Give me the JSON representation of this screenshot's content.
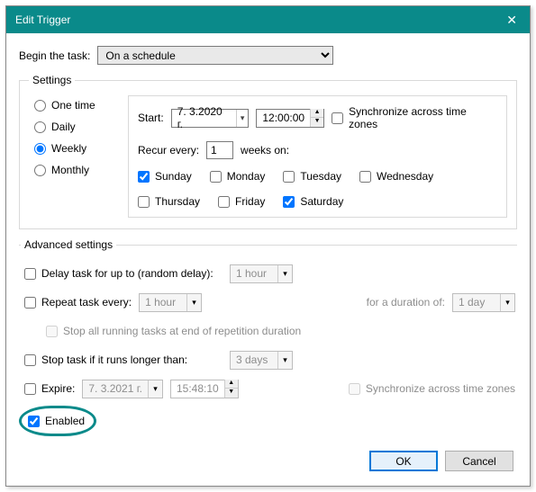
{
  "titlebar": {
    "title": "Edit Trigger",
    "close": "✕"
  },
  "begin": {
    "label": "Begin the task:",
    "value": "On a schedule"
  },
  "settings": {
    "legend": "Settings",
    "schedule": {
      "one_time": "One time",
      "daily": "Daily",
      "weekly": "Weekly",
      "monthly": "Monthly",
      "selected": "weekly"
    },
    "start": {
      "label": "Start:",
      "date": "7.  3.2020 г.",
      "time": "12:00:00",
      "sync_label": "Synchronize across time zones"
    },
    "recur": {
      "label_before": "Recur every:",
      "value": "1",
      "label_after": "weeks on:"
    },
    "days": {
      "sunday": "Sunday",
      "monday": "Monday",
      "tuesday": "Tuesday",
      "wednesday": "Wednesday",
      "thursday": "Thursday",
      "friday": "Friday",
      "saturday": "Saturday"
    }
  },
  "advanced": {
    "legend": "Advanced settings",
    "delay": {
      "label": "Delay task for up to (random delay):",
      "value": "1 hour"
    },
    "repeat": {
      "label": "Repeat task every:",
      "value": "1 hour",
      "duration_label": "for a duration of:",
      "duration_value": "1 day"
    },
    "stop_repeat": {
      "label": "Stop all running tasks at end of repetition duration"
    },
    "stop_after": {
      "label": "Stop task if it runs longer than:",
      "value": "3 days"
    },
    "expire": {
      "label": "Expire:",
      "date": "7.  3.2021 г.",
      "time": "15:48:10",
      "sync_label": "Synchronize across time zones"
    },
    "enabled": {
      "label": "Enabled"
    }
  },
  "buttons": {
    "ok": "OK",
    "cancel": "Cancel"
  }
}
